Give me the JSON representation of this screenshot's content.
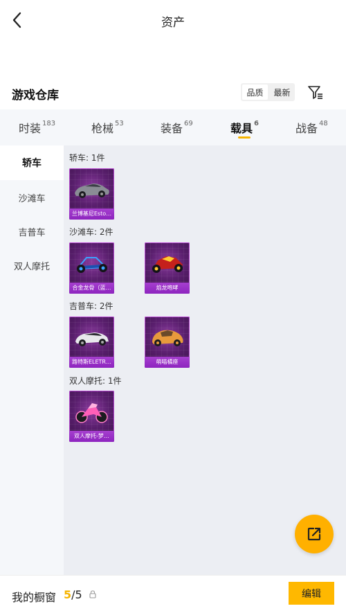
{
  "header": {
    "title": "资产",
    "back_icon": "chevron-left-icon"
  },
  "warehouse": {
    "title": "游戏仓库",
    "sort_options": [
      "品质",
      "最新"
    ],
    "filter_icon": "filter-icon"
  },
  "tabs": [
    {
      "label": "时装",
      "count": "183"
    },
    {
      "label": "枪械",
      "count": "53"
    },
    {
      "label": "装备",
      "count": "69"
    },
    {
      "label": "载具",
      "count": "6",
      "active": true
    },
    {
      "label": "战备",
      "count": "48"
    }
  ],
  "sidebar": {
    "items": [
      {
        "label": "轿车",
        "active": true
      },
      {
        "label": "沙滩车"
      },
      {
        "label": "吉普车"
      },
      {
        "label": "双人摩托"
      }
    ]
  },
  "groups": [
    {
      "label": "轿车: 1件",
      "items": [
        {
          "name": "兰博基尼Esto…"
        }
      ]
    },
    {
      "label": "沙滩车: 2件",
      "items": [
        {
          "name": "合金龙骨（蓝…"
        },
        {
          "name": "焰龙咆哮"
        }
      ]
    },
    {
      "label": "吉普车: 2件",
      "items": [
        {
          "name": "路特斯ELETR…"
        },
        {
          "name": "萌喵橘座"
        }
      ]
    },
    {
      "label": "双人摩托: 1件",
      "items": [
        {
          "name": "双人摩托-梦…"
        }
      ]
    }
  ],
  "fab": {
    "icon": "share-icon"
  },
  "bottom_bar": {
    "label": "我的橱窗",
    "count_current": "5",
    "count_total": "/5",
    "lock_icon": "lock-icon",
    "edit_label": "编辑"
  },
  "colors": {
    "accent": "#ffb800",
    "card_bg": "#5a1f6e",
    "card_label": "#9b2fc7"
  }
}
